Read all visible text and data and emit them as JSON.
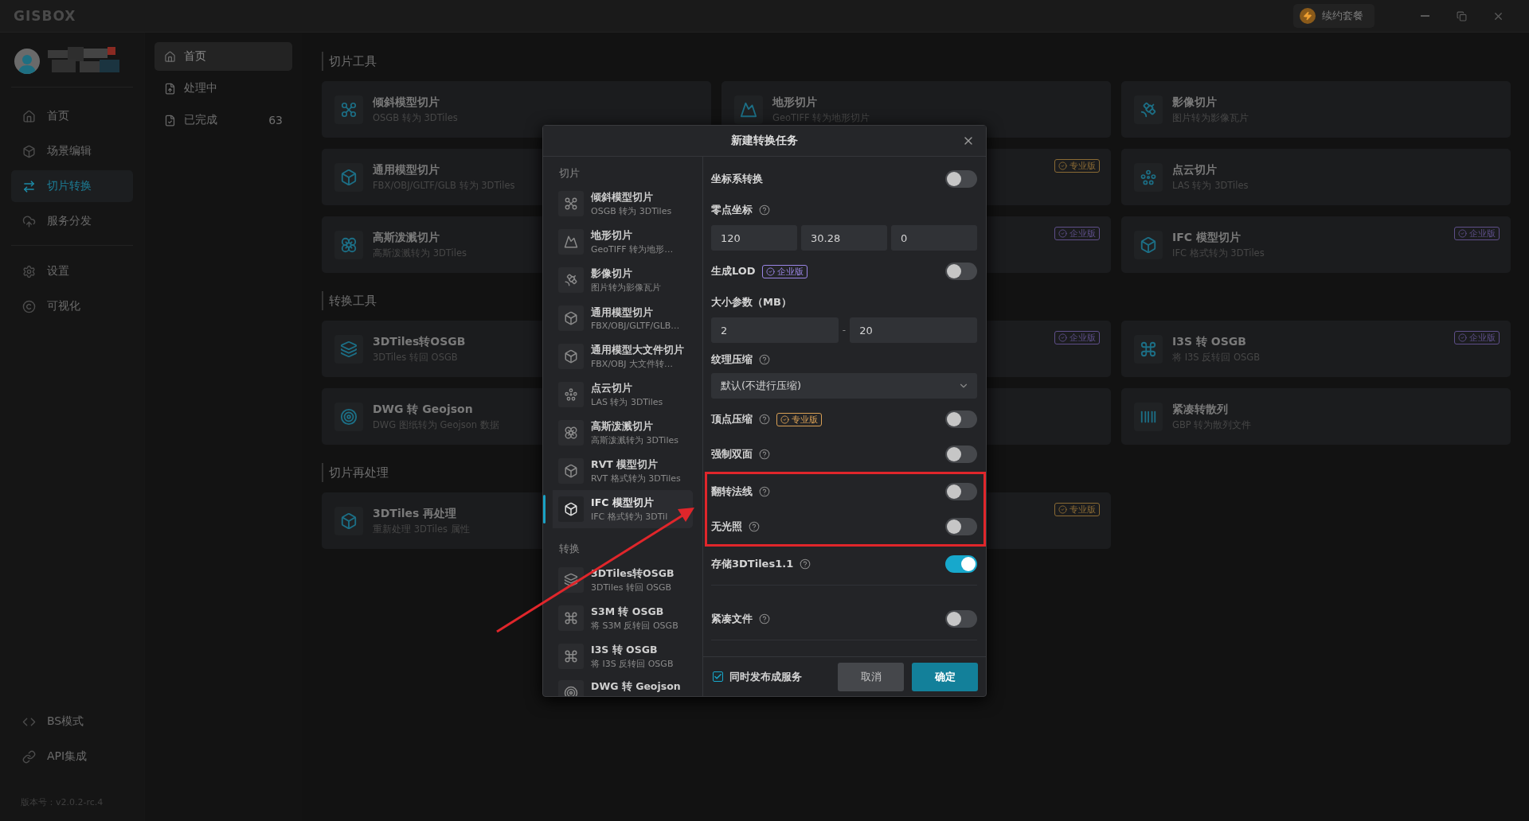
{
  "title_bar": {
    "logo": "GISBOX",
    "renew_button": "续约套餐"
  },
  "nav": [
    {
      "label": "首页",
      "selected": false
    },
    {
      "label": "场景编辑",
      "selected": false
    },
    {
      "label": "切片转换",
      "selected": true
    },
    {
      "label": "服务分发",
      "selected": false
    }
  ],
  "nav_lower": [
    {
      "label": "设置",
      "selected": false
    },
    {
      "label": "可视化",
      "selected": false
    }
  ],
  "nav_bottom": [
    {
      "label": "BS模式",
      "selected": false
    },
    {
      "label": "API集成",
      "selected": false
    }
  ],
  "version": "版本号：v2.0.2-rc.4",
  "task_filters": [
    {
      "label": "首页",
      "selected": true
    },
    {
      "label": "处理中",
      "selected": false
    },
    {
      "label": "已完成",
      "selected": false,
      "count": "63"
    }
  ],
  "sections": [
    {
      "title": "切片工具",
      "cards": [
        {
          "title": "倾斜模型切片",
          "desc": "OSGB 转为 3DTiles",
          "kind": "drone"
        },
        {
          "title": "地形切片",
          "desc": "GeoTIFF 转为地形切片",
          "kind": "terrain"
        },
        {
          "title": "影像切片",
          "desc": "图片转为影像瓦片",
          "kind": "imagery"
        },
        {
          "title": "通用模型切片",
          "desc": "FBX/OBJ/GLTF/GLB 转为 3DTiles",
          "kind": "cube"
        },
        {
          "kind": "blank",
          "badge": {
            "text": "专业版",
            "kind": "pro"
          }
        },
        {
          "title": "点云切片",
          "desc": "LAS 转为 3DTiles",
          "kind": "points"
        },
        {
          "title": "高斯泼溅切片",
          "desc": "高斯泼溅转为 3DTiles",
          "kind": "gauss"
        },
        {
          "kind": "blank",
          "badge": {
            "text": "企业版",
            "kind": "enterprise"
          }
        },
        {
          "title": "IFC 模型切片",
          "desc": "IFC 格式转为 3DTiles",
          "kind": "cube",
          "badge": {
            "text": "企业版",
            "kind": "enterprise"
          }
        }
      ]
    },
    {
      "title": "转换工具",
      "cards": [
        {
          "title": "3DTiles转OSGB",
          "desc": "3DTiles 转回 OSGB",
          "kind": "layers"
        },
        {
          "kind": "blank",
          "badge": {
            "text": "企业版",
            "kind": "enterprise"
          }
        },
        {
          "title": "I3S 转 OSGB",
          "desc": "将 I3S 反转回 OSGB",
          "kind": "command",
          "badge": {
            "text": "企业版",
            "kind": "enterprise"
          }
        },
        {
          "title": "DWG 转 Geojson",
          "desc": "DWG 图纸转为 Geojson 数据",
          "kind": "target"
        },
        {
          "kind": "blank"
        },
        {
          "title": "紧凑转散列",
          "desc": "GBP 转为散列文件",
          "kind": "bars"
        }
      ]
    },
    {
      "title": "切片再处理",
      "cards": [
        {
          "title": "3DTiles 再处理",
          "desc": "重新处理 3DTiles 属性",
          "kind": "cube"
        },
        {
          "kind": "blank",
          "badge": {
            "text": "专业版",
            "kind": "pro"
          }
        }
      ]
    }
  ],
  "dialog": {
    "title": "新建转换任务",
    "task_types": [
      {
        "group": "切片",
        "items": [
          {
            "title": "倾斜模型切片",
            "desc": "OSGB 转为 3DTiles",
            "kind": "drone",
            "selected": false
          },
          {
            "title": "地形切片",
            "desc": "GeoTIFF 转为地形…",
            "kind": "terrain",
            "selected": false
          },
          {
            "title": "影像切片",
            "desc": "图片转为影像瓦片",
            "kind": "imagery",
            "selected": false
          },
          {
            "title": "通用模型切片",
            "desc": "FBX/OBJ/GLTF/GLB…",
            "kind": "cube",
            "selected": false
          },
          {
            "title": "通用模型大文件切片",
            "desc": "FBX/OBJ 大文件转…",
            "kind": "cube",
            "selected": false
          },
          {
            "title": "点云切片",
            "desc": "LAS 转为 3DTiles",
            "kind": "points",
            "selected": false
          },
          {
            "title": "高斯泼溅切片",
            "desc": "高斯泼溅转为 3DTiles",
            "kind": "gauss",
            "selected": false
          },
          {
            "title": "RVT 模型切片",
            "desc": "RVT 格式转为 3DTiles",
            "kind": "cube",
            "selected": false
          },
          {
            "title": "IFC 模型切片",
            "desc": "IFC 格式转为 3DTil",
            "kind": "cube",
            "selected": true
          }
        ]
      },
      {
        "group": "转换",
        "items": [
          {
            "title": "3DTiles转OSGB",
            "desc": "3DTiles 转回 OSGB",
            "kind": "layers",
            "selected": false
          },
          {
            "title": "S3M 转 OSGB",
            "desc": "将 S3M 反转回 OSGB",
            "kind": "command",
            "selected": false
          },
          {
            "title": "I3S 转 OSGB",
            "desc": "将 I3S 反转回 OSGB",
            "kind": "command",
            "selected": false
          },
          {
            "title": "DWG 转 Geojson",
            "kind": "target",
            "selected": false
          }
        ]
      }
    ],
    "settings": [
      {
        "kind": "toggle",
        "label": "坐标系转换",
        "on": false
      },
      {
        "kind": "inputs",
        "label": "零点坐标",
        "help": true,
        "values": [
          "120",
          "30.28",
          "0"
        ]
      },
      {
        "kind": "toggle",
        "label": "生成LOD",
        "badge": {
          "text": "企业版",
          "kind": "enterprise"
        },
        "on": false
      },
      {
        "kind": "range",
        "label": "大小参数（MB）",
        "values": [
          "2",
          "20"
        ],
        "separator": "-"
      },
      {
        "kind": "select",
        "label": "纹理压缩",
        "help": true,
        "value": "默认(不进行压缩)"
      },
      {
        "kind": "toggle",
        "label": "顶点压缩",
        "help": true,
        "badge": {
          "text": "专业版",
          "kind": "pro"
        },
        "on": false
      },
      {
        "kind": "toggle",
        "label": "强制双面",
        "help": true,
        "on": false
      },
      {
        "kind": "toggle",
        "label": "翻转法线",
        "help": true,
        "on": false,
        "highlighted": true
      },
      {
        "kind": "toggle",
        "label": "无光照",
        "help": true,
        "on": false,
        "highlighted": true
      },
      {
        "kind": "toggle",
        "label": "存储3DTiles1.1",
        "help": true,
        "on": true,
        "divider": true
      },
      {
        "kind": "toggle",
        "label": "紧凑文件",
        "help": true,
        "on": false,
        "divider": true
      }
    ],
    "publish": {
      "label": "同时发布成服务",
      "checked": true
    },
    "buttons": [
      {
        "label": "取消",
        "kind": "secondary"
      },
      {
        "label": "确定",
        "kind": "primary"
      }
    ]
  }
}
